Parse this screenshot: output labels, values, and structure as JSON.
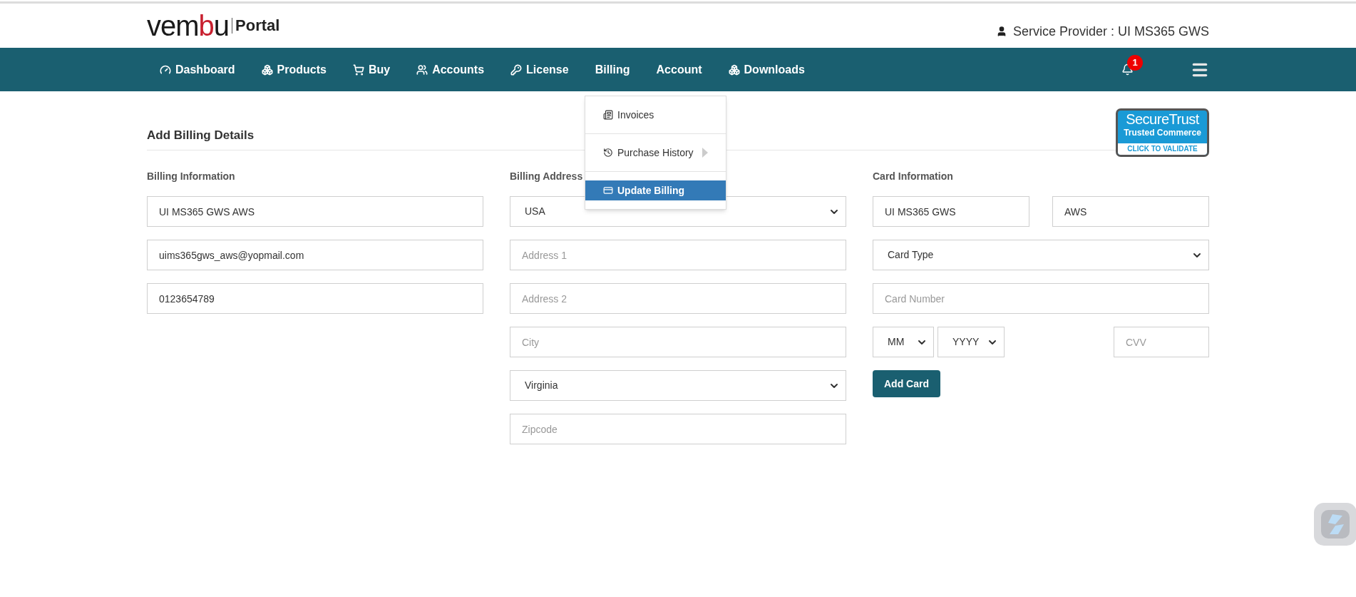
{
  "brand": {
    "logo_parts": [
      {
        "text": "vem",
        "color": "#1a1a1a"
      },
      {
        "text": "b",
        "color": "#c8202f"
      },
      {
        "text": "u",
        "color": "#1a1a1a"
      }
    ],
    "product": "Portal"
  },
  "user": {
    "label": "Service Provider : UI MS365 GWS"
  },
  "nav": {
    "items": [
      {
        "label": "Dashboard",
        "kind": "dashboard"
      },
      {
        "label": "Products",
        "kind": "products"
      },
      {
        "label": "Buy",
        "kind": "buy"
      },
      {
        "label": "Accounts",
        "kind": "accounts"
      },
      {
        "label": "License",
        "kind": "license"
      },
      {
        "label": "Billing",
        "kind": "plain"
      },
      {
        "label": "Account",
        "kind": "plain"
      },
      {
        "label": "Downloads",
        "kind": "downloads"
      }
    ],
    "notifications": {
      "count": "1"
    }
  },
  "billing_menu": {
    "items": [
      {
        "label": "Invoices",
        "kind": "invoices",
        "selected": false,
        "has_submenu": false
      },
      {
        "label": "Purchase History",
        "kind": "history",
        "selected": false,
        "has_submenu": true
      },
      {
        "label": "Update Billing",
        "kind": "billing",
        "selected": true,
        "has_submenu": false
      }
    ]
  },
  "page_title": "Add Billing Details",
  "trust_badge": {
    "line_1": "SecureTrust",
    "line_2": "Trusted Commerce",
    "line_3": "CLICK TO VALIDATE"
  },
  "sections": [
    {
      "title": "Billing Information",
      "rows": [
        {
          "kind": "full",
          "fields": [
            {
              "kind": "input",
              "value": "UI MS365 GWS AWS"
            }
          ]
        },
        {
          "kind": "full",
          "fields": [
            {
              "kind": "input",
              "value": "uims365gws_aws@yopmail.com"
            }
          ]
        },
        {
          "kind": "full",
          "fields": [
            {
              "kind": "input",
              "value": "0123654789"
            }
          ]
        }
      ]
    },
    {
      "title": "Billing Address",
      "rows": [
        {
          "kind": "full",
          "fields": [
            {
              "kind": "select",
              "value": "USA"
            }
          ]
        },
        {
          "kind": "full",
          "fields": [
            {
              "kind": "input",
              "placeholder": "Address 1"
            }
          ]
        },
        {
          "kind": "full",
          "fields": [
            {
              "kind": "input",
              "placeholder": "Address 2"
            }
          ]
        },
        {
          "kind": "full",
          "fields": [
            {
              "kind": "input",
              "placeholder": "City"
            }
          ]
        },
        {
          "kind": "full",
          "fields": [
            {
              "kind": "select",
              "value": "Virginia"
            }
          ]
        },
        {
          "kind": "full",
          "fields": [
            {
              "kind": "input",
              "placeholder": "Zipcode"
            }
          ]
        }
      ]
    },
    {
      "title": "Card Information",
      "rows": [
        {
          "kind": "pair",
          "fields": [
            {
              "kind": "input",
              "value": "UI MS365 GWS"
            },
            {
              "kind": "input",
              "value": "AWS"
            }
          ]
        },
        {
          "kind": "full",
          "fields": [
            {
              "kind": "select",
              "value": "Card Type"
            }
          ]
        },
        {
          "kind": "full",
          "fields": [
            {
              "kind": "input",
              "placeholder": "Card Number"
            }
          ]
        },
        {
          "kind": "expiry",
          "fields": [
            {
              "kind": "select",
              "value": "MM"
            },
            {
              "kind": "select",
              "value": "YYYY"
            },
            {
              "kind": "input",
              "placeholder": "CVV"
            }
          ]
        }
      ],
      "button": "Add Card"
    }
  ]
}
